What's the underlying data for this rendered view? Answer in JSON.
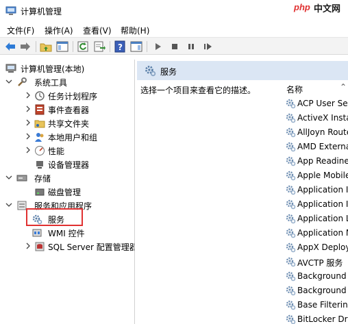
{
  "window": {
    "title": "计算机管理"
  },
  "watermark": {
    "text": "中文网",
    "logo": "php"
  },
  "menu": [
    "文件(F)",
    "操作(A)",
    "查看(V)",
    "帮助(H)"
  ],
  "toolbar": {
    "buttons": [
      "back-arrow",
      "forward-arrow",
      "up-folder",
      "show-hide-tree",
      "refresh",
      "export-list",
      "help",
      "show-hide-action-pane",
      "start",
      "stop",
      "pause",
      "restart"
    ]
  },
  "tree": {
    "root": "计算机管理(本地)",
    "system_tools": "系统工具",
    "task_scheduler": "任务计划程序",
    "event_viewer": "事件查看器",
    "shared_folders": "共享文件夹",
    "local_users": "本地用户和组",
    "performance": "性能",
    "device_manager": "设备管理器",
    "storage": "存储",
    "disk_management": "磁盘管理",
    "services_apps": "服务和应用程序",
    "services": "服务",
    "wmi": "WMI 控件",
    "sql_server": "SQL Server 配置管理器"
  },
  "right": {
    "header": "服务",
    "description": "选择一个项目来查看它的描述。",
    "column_name": "名称",
    "services": [
      "ACP User Ser",
      "ActiveX Insta",
      "AllJoyn Route",
      "AMD Externa",
      "App Readine",
      "Apple Mobile",
      "Application I",
      "Application I",
      "Application L",
      "Application M",
      "AppX Deploy",
      "AVCTP 服务",
      "Background",
      "Background",
      "Base Filtering",
      "BitLocker Driv"
    ]
  },
  "colors": {
    "selection_box": "#e03030",
    "header_bg": "#dbe6f4"
  }
}
